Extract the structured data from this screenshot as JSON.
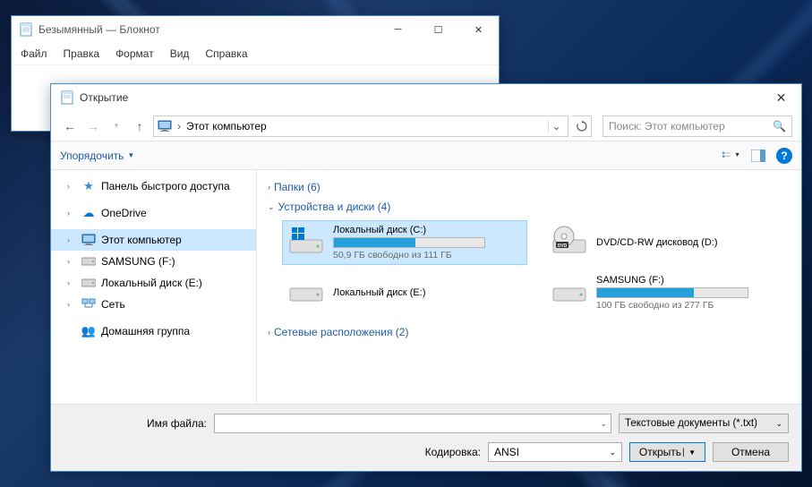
{
  "notepad": {
    "title": "Безымянный — Блокнот",
    "menu": [
      "Файл",
      "Правка",
      "Формат",
      "Вид",
      "Справка"
    ]
  },
  "dialog": {
    "title": "Открытие",
    "location": "Этот компьютер",
    "search_placeholder": "Поиск: Этот компьютер",
    "organize": "Упорядочить",
    "tree": {
      "quick": "Панель быстрого доступа",
      "onedrive": "OneDrive",
      "thispc": "Этот компьютер",
      "samsung": "SAMSUNG (F:)",
      "locale": "Локальный диск (E:)",
      "network": "Сеть",
      "homegroup": "Домашняя группа"
    },
    "sections": {
      "folders": "Папки (6)",
      "devices": "Устройства и диски (4)",
      "netloc": "Сетевые расположения (2)"
    },
    "drives": {
      "c": {
        "name": "Локальный диск (C:)",
        "free": "50,9 ГБ свободно из 111 ГБ"
      },
      "d": {
        "name": "DVD/CD-RW дисковод (D:)"
      },
      "e": {
        "name": "Локальный диск (E:)"
      },
      "f": {
        "name": "SAMSUNG (F:)",
        "free": "100 ГБ свободно из 277 ГБ"
      }
    },
    "filename_label": "Имя файла:",
    "encoding_label": "Кодировка:",
    "encoding_value": "ANSI",
    "filetype": "Текстовые документы (*.txt)",
    "open_btn": "Открыть",
    "cancel_btn": "Отмена"
  }
}
